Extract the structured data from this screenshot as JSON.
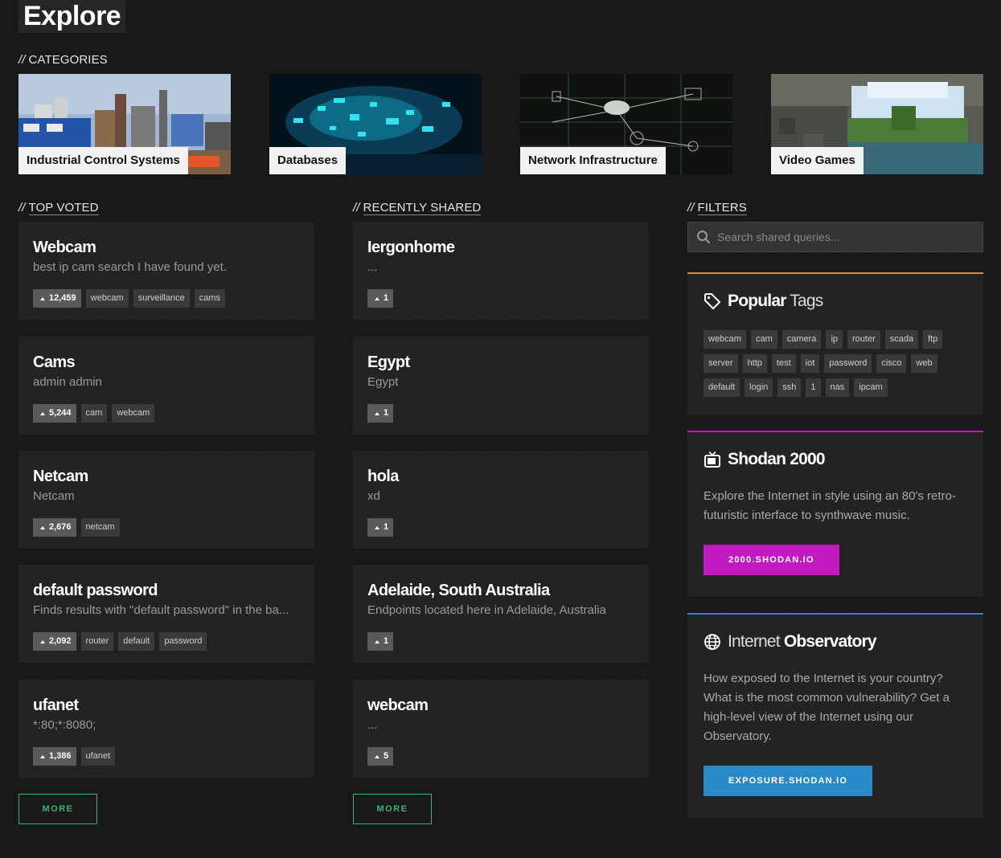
{
  "page": {
    "title": "Explore"
  },
  "sections": {
    "categories": "CATEGORIES",
    "top_voted": "TOP VOTED",
    "recently_shared": "RECENTLY SHARED",
    "filters": "FILTERS",
    "prefix": "//"
  },
  "categories": [
    {
      "label": "Industrial Control Systems"
    },
    {
      "label": "Databases"
    },
    {
      "label": "Network Infrastructure"
    },
    {
      "label": "Video Games"
    }
  ],
  "top_voted": [
    {
      "title": "Webcam",
      "desc": "best ip cam search I have found yet.",
      "votes": "12,459",
      "tags": [
        "webcam",
        "surveillance",
        "cams"
      ]
    },
    {
      "title": "Cams",
      "desc": "admin admin",
      "votes": "5,244",
      "tags": [
        "cam",
        "webcam"
      ]
    },
    {
      "title": "Netcam",
      "desc": "Netcam",
      "votes": "2,676",
      "tags": [
        "netcam"
      ]
    },
    {
      "title": "default password",
      "desc": "Finds results with \"default password\" in the ba...",
      "votes": "2,092",
      "tags": [
        "router",
        "default",
        "password"
      ]
    },
    {
      "title": "ufanet",
      "desc": "*:80;*:8080;",
      "votes": "1,386",
      "tags": [
        "ufanet"
      ]
    }
  ],
  "recently_shared": [
    {
      "title": "Iergonhome",
      "desc": "...",
      "votes": "1",
      "tags": []
    },
    {
      "title": "Egypt",
      "desc": "Egypt",
      "votes": "1",
      "tags": []
    },
    {
      "title": "hola",
      "desc": "xd",
      "votes": "1",
      "tags": []
    },
    {
      "title": "Adelaide, South Australia",
      "desc": "Endpoints located here in Adelaide, Australia",
      "votes": "1",
      "tags": []
    },
    {
      "title": "webcam",
      "desc": "...",
      "votes": "5",
      "tags": []
    }
  ],
  "more_label": "MORE",
  "search": {
    "placeholder": "Search shared queries..."
  },
  "popular_tags": {
    "title_bold": "Popular",
    "title_light": "Tags",
    "accent": "#e8882a",
    "tags": [
      "webcam",
      "cam",
      "camera",
      "ip",
      "router",
      "scada",
      "ftp",
      "server",
      "http",
      "test",
      "iot",
      "password",
      "cisco",
      "web",
      "default",
      "login",
      "ssh",
      "1",
      "nas",
      "ipcam"
    ]
  },
  "shodan2000": {
    "title": "Shodan 2000",
    "text": "Explore the Internet in style using an 80's retro-futuristic interface to synthwave music.",
    "button": "2000.SHODAN.IO",
    "accent": "#c21ac2"
  },
  "observatory": {
    "title_light": "Internet",
    "title_bold": "Observatory",
    "text": "How exposed to the Internet is your country? What is the most common vulnerability? Get a high-level view of the Internet using our Observatory.",
    "button": "EXPOSURE.SHODAN.IO",
    "accent": "#2a8ac7"
  }
}
